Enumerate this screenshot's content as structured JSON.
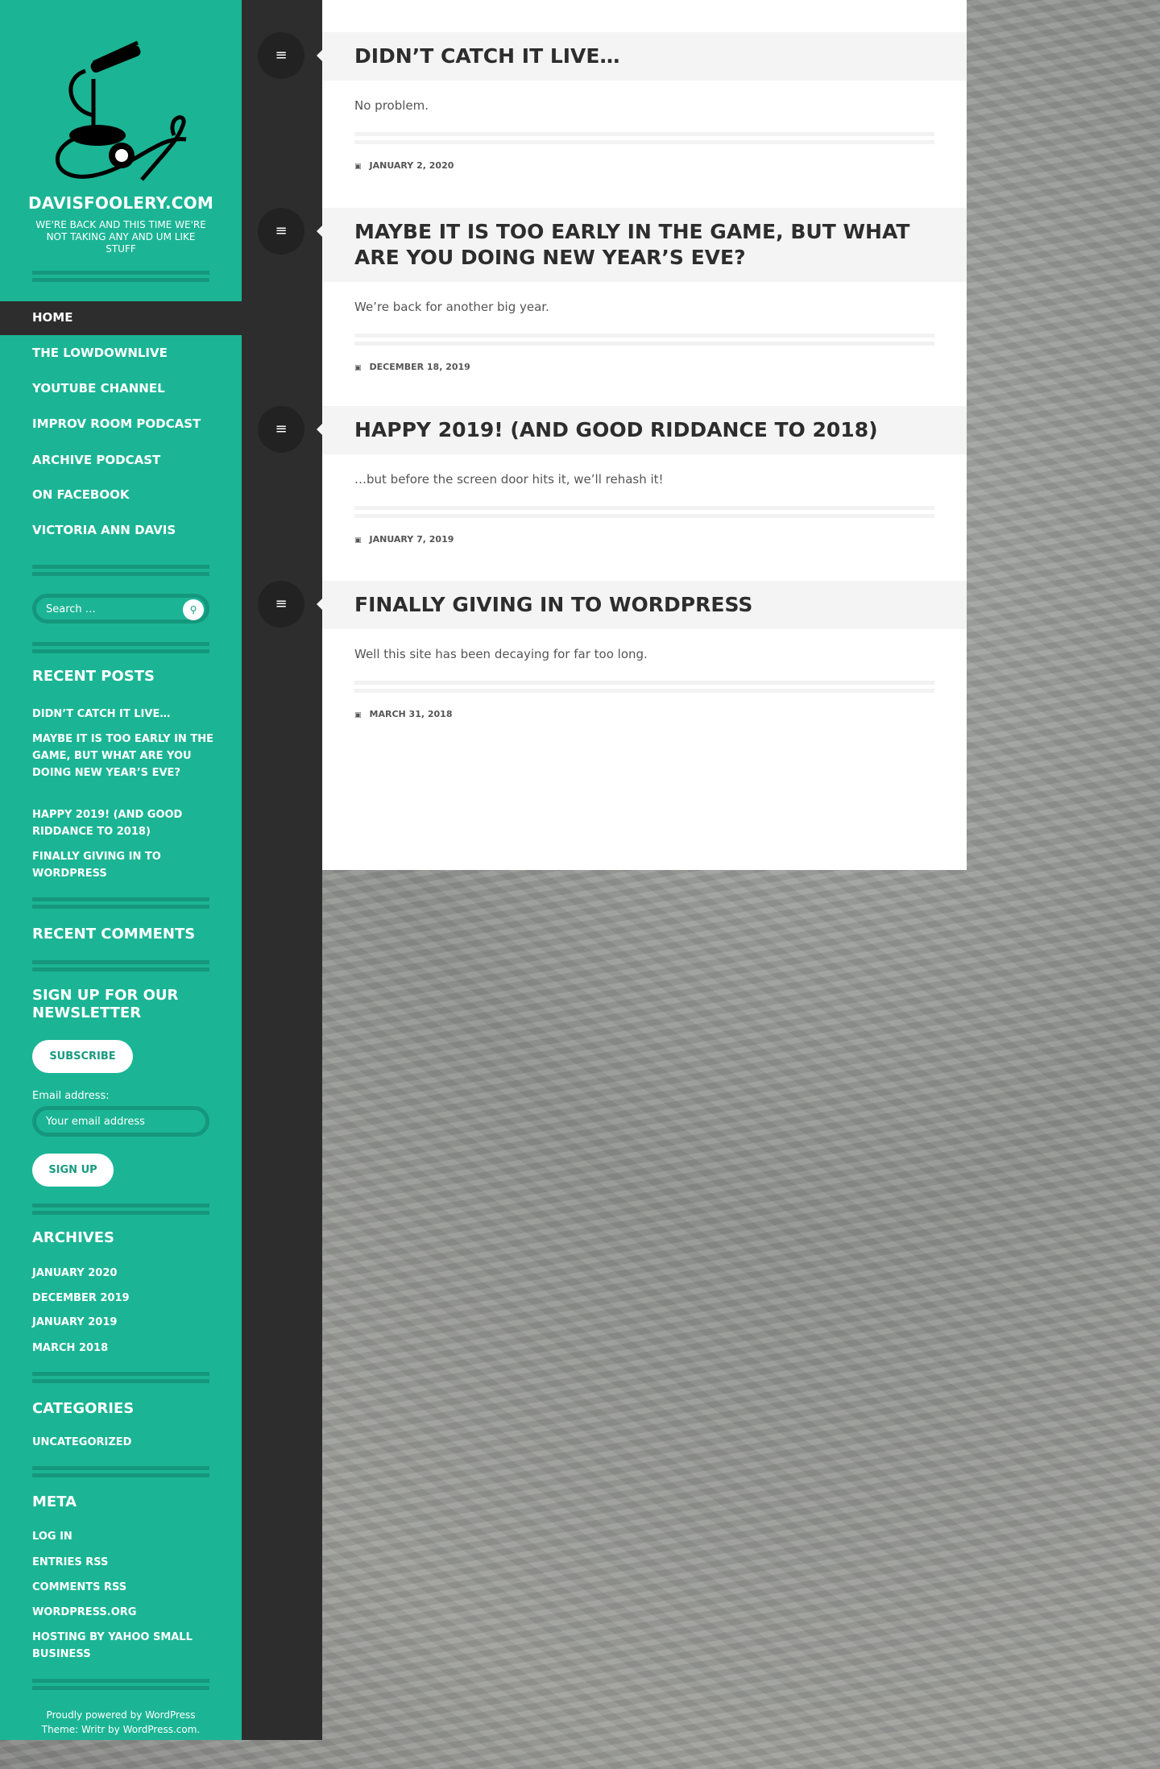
{
  "site": {
    "title": "DAVISFOOLERY.COM",
    "tagline": "WE'RE BACK AND THIS TIME WE'RE NOT TAKING ANY AND UM LIKE STUFF"
  },
  "nav": [
    "HOME",
    "THE LOWDOWNLIVE",
    "YOUTUBE CHANNEL",
    "IMPROV ROOM PODCAST",
    "ARCHIVE PODCAST",
    "ON FACEBOOK",
    "VICTORIA ANN DAVIS"
  ],
  "search": {
    "placeholder": "Search …"
  },
  "recent_posts": {
    "heading": "RECENT POSTS",
    "items": [
      "DIDN’T CATCH IT LIVE…",
      "MAYBE IT IS TOO EARLY IN THE GAME, BUT WHAT ARE YOU DOING NEW YEAR’S EVE?",
      "HAPPY 2019! (AND GOOD RIDDANCE TO 2018)",
      "FINALLY GIVING IN TO WORDPRESS"
    ]
  },
  "recent_comments": {
    "heading": "RECENT COMMENTS"
  },
  "newsletter": {
    "heading": "SIGN UP FOR OUR NEWSLETTER",
    "subscribe": "SUBSCRIBE",
    "email_label": "Email address:",
    "email_placeholder": "Your email address",
    "signup": "SIGN UP"
  },
  "archives": {
    "heading": "ARCHIVES",
    "items": [
      "JANUARY 2020",
      "DECEMBER 2019",
      "JANUARY 2019",
      "MARCH 2018"
    ]
  },
  "categories": {
    "heading": "CATEGORIES",
    "items": [
      "UNCATEGORIZED"
    ]
  },
  "meta": {
    "heading": "META",
    "items": [
      "LOG IN",
      "ENTRIES RSS",
      "COMMENTS RSS",
      "WORDPRESS.ORG",
      "HOSTING BY YAHOO SMALL BUSINESS"
    ]
  },
  "footer": {
    "line1": "Proudly powered by WordPress",
    "line2": "Theme: Writr by WordPress.com."
  },
  "posts": [
    {
      "title": "DIDN’T CATCH IT LIVE…",
      "excerpt": "No problem.",
      "date": "JANUARY 2, 2020"
    },
    {
      "title": "MAYBE IT IS TOO EARLY IN THE GAME, BUT WHAT ARE YOU DOING NEW YEAR’S EVE?",
      "excerpt": "We’re back for another big year.",
      "date": "DECEMBER 18, 2019"
    },
    {
      "title": "HAPPY 2019! (AND GOOD RIDDANCE TO 2018)",
      "excerpt": "…but before the screen door hits it, we’ll rehash it!",
      "date": "JANUARY 7, 2019"
    },
    {
      "title": "FINALLY GIVING IN TO WORDPRESS",
      "excerpt": "Well this site has been decaying for far too long.",
      "date": "MARCH 31, 2018"
    }
  ]
}
